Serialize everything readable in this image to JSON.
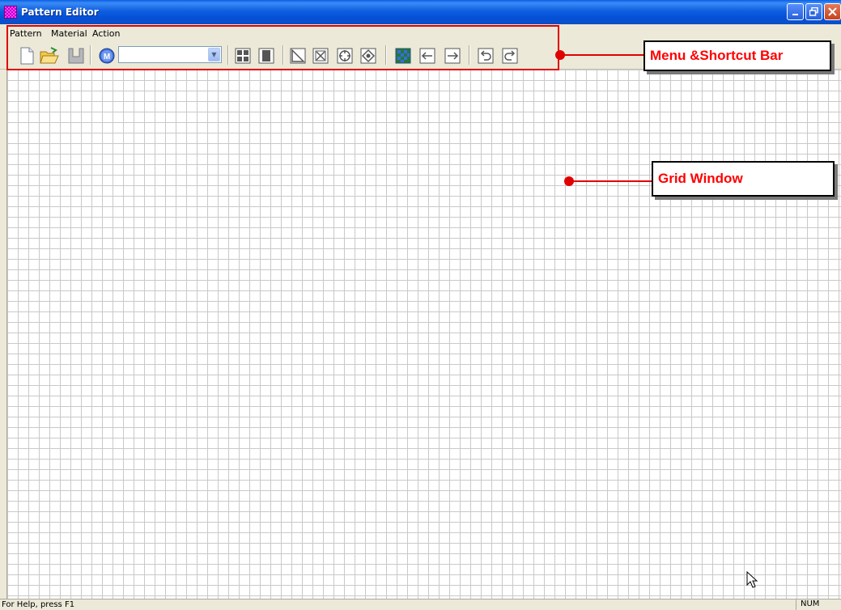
{
  "window": {
    "title": "Pattern Editor",
    "controls": [
      "minimize",
      "restore",
      "close"
    ]
  },
  "menu": {
    "items": [
      "Pattern",
      "Material",
      "Action"
    ]
  },
  "toolbar": {
    "material_select": {
      "value": ""
    },
    "icons": [
      "new-file-icon",
      "open-folder-icon",
      "save-icon",
      "material-icon",
      "grid-expand-icon",
      "fill-column-icon",
      "triangle-icon",
      "x-box-icon",
      "rotate-icon",
      "rotate-diamond-icon",
      "pattern-fill-icon",
      "arrow-left-icon",
      "arrow-right-icon",
      "undo-icon",
      "redo-icon"
    ]
  },
  "annotations": {
    "menu_shortcut_label": "Menu &Shortcut Bar",
    "grid_window_label": "Grid Window",
    "color": "#e00000"
  },
  "statusbar": {
    "help_text": "For Help, press F1",
    "num_indicator": "NUM"
  }
}
